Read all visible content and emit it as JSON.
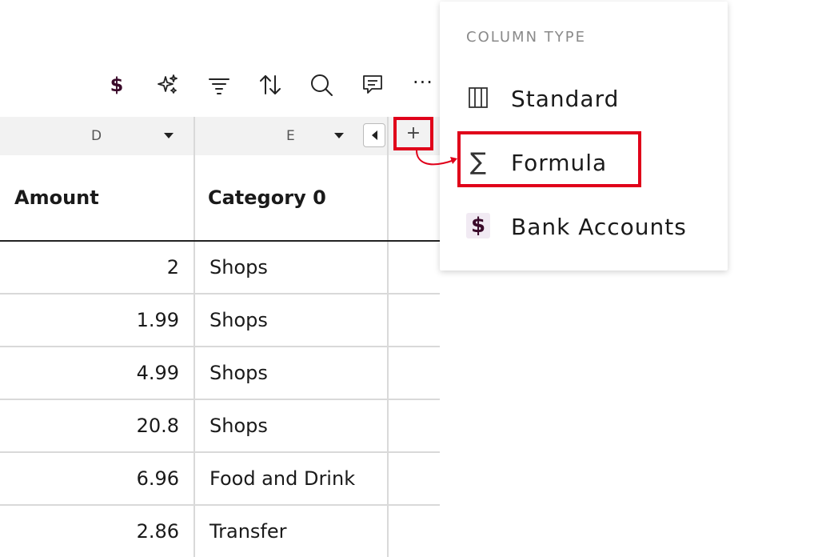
{
  "toolbar": {
    "dollar_symbol": "$",
    "more_symbol": "···"
  },
  "grid": {
    "columns": [
      {
        "letter": "D",
        "name": "Amount"
      },
      {
        "letter": "E",
        "name": "Category 0"
      }
    ],
    "add_column_symbol": "+",
    "rows": [
      {
        "amount": "2",
        "category": "Shops"
      },
      {
        "amount": "1.99",
        "category": "Shops"
      },
      {
        "amount": "4.99",
        "category": "Shops"
      },
      {
        "amount": "20.8",
        "category": "Shops"
      },
      {
        "amount": "6.96",
        "category": "Food and Drink"
      },
      {
        "amount": "2.86",
        "category": "Transfer"
      }
    ]
  },
  "menu": {
    "heading": "COLUMN TYPE",
    "items": [
      {
        "label": "Standard",
        "icon": "standard-column-icon"
      },
      {
        "label": "Formula",
        "icon": "sigma-icon"
      },
      {
        "label": "Bank Accounts",
        "icon": "dollar-icon"
      }
    ],
    "sigma_symbol": "∑",
    "bank_symbol": "$"
  },
  "colors": {
    "highlight": "#e0001a",
    "brand": "#3a0a2a"
  }
}
